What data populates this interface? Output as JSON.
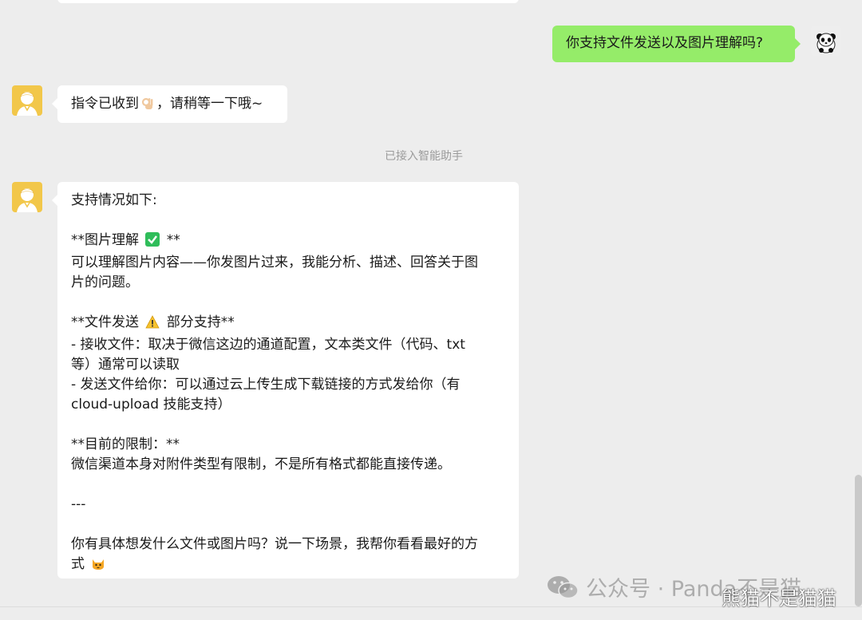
{
  "conversation": {
    "outgoing": {
      "text": "你支持文件发送以及图片理解吗?"
    },
    "ack": {
      "text_before": "指令已收到",
      "emoji": "ok-hand",
      "text_after": "，请稍等一下哦~"
    },
    "system_note": "已接入智能助手",
    "reply": {
      "line1": "支持情况如下:",
      "line2": "",
      "line3_pre": "**图片理解 ",
      "line3_post": " **",
      "line4": "可以理解图片内容——你发图片过来，我能分析、描述、回答关于图",
      "line5": "片的问题。",
      "line6": "",
      "line7_pre": "**文件发送 ",
      "line7_post": " 部分支持**",
      "line8": "- 接收文件：取决于微信这边的通道配置，文本类文件（代码、txt",
      "line9": "等）通常可以读取",
      "line10": "- 发送文件给你：可以通过云上传生成下载链接的方式发给你（有",
      "line11": "cloud-upload 技能支持）",
      "line12": "",
      "line13": "**目前的限制：**",
      "line14": "微信渠道本身对附件类型有限制，不是所有格式都能直接传递。",
      "line15": "",
      "line16": "---",
      "line17": "",
      "line18": "你有具体想发什么文件或图片吗？说一下场景，我帮你看看最好的方",
      "line19_pre": "式 "
    }
  },
  "watermark": {
    "main": "公众号 · Panda不是猫",
    "sub": "熊猫不是猫猫"
  },
  "colors": {
    "background": "#ededed",
    "incoming_bubble": "#ffffff",
    "outgoing_bubble": "#95ec69",
    "system_text": "#9b9b9b"
  }
}
